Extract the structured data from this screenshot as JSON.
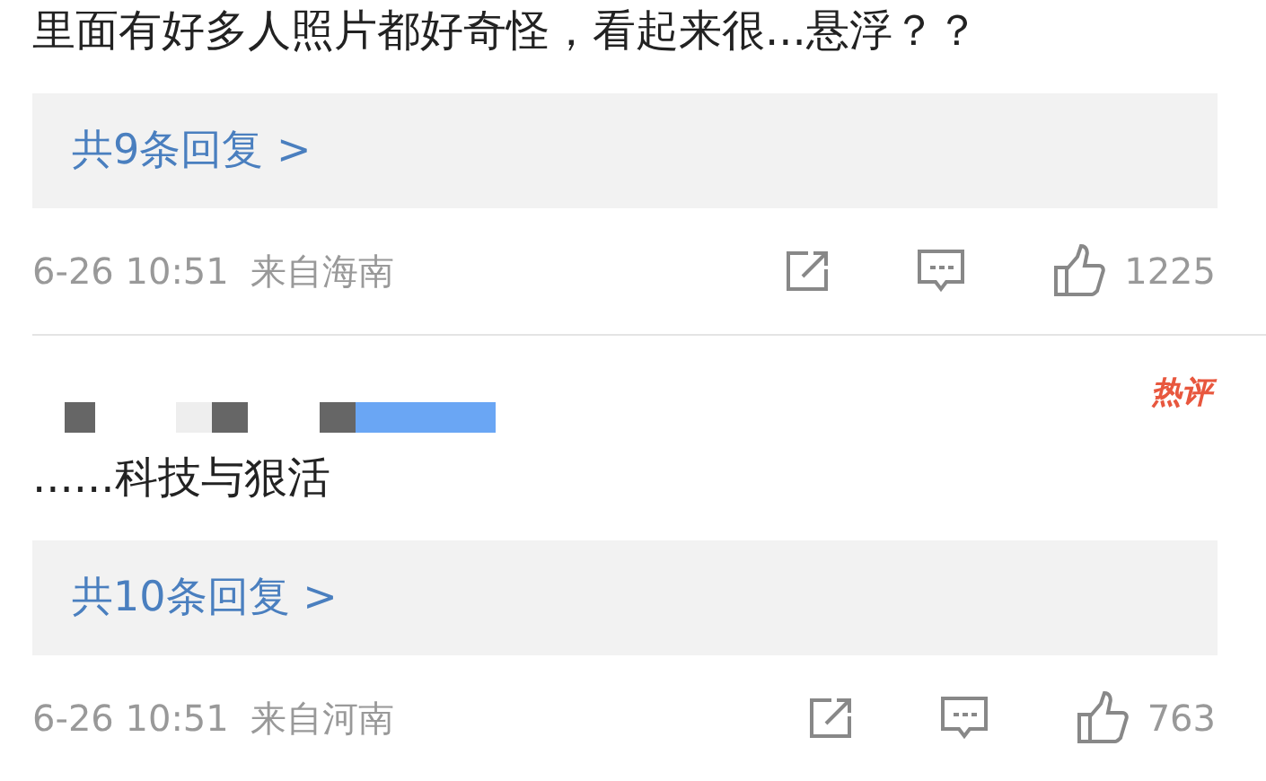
{
  "comments": [
    {
      "text": "里面有好多人照片都好奇怪，看起来很...悬浮？？",
      "replies": "共9条回复 >",
      "time": "6-26 10:51",
      "source": "来自海南",
      "likes": "1225",
      "redacted_name": false
    },
    {
      "badge": "热评",
      "text": "......科技与狠活",
      "replies": "共10条回复 >",
      "time": "6-26 10:51",
      "source": "来自河南",
      "likes": "763",
      "redacted_name": true
    }
  ]
}
